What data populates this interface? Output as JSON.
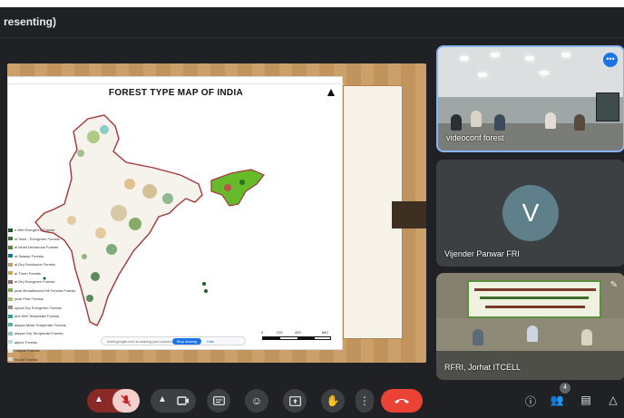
{
  "presentation": {
    "title_partial": "resenting)",
    "map_title": "FOREST TYPE MAP OF INDIA",
    "legend": [
      {
        "label": "e Wet Evergreen Forests",
        "color": "#1b5e20"
      },
      {
        "label": "al Semi - Evergreen Forests",
        "color": "#2e7d32"
      },
      {
        "label": "al Moist Deciduous Forests",
        "color": "#558b2f"
      },
      {
        "label": "al Swamp Forests",
        "color": "#00838f"
      },
      {
        "label": "al Dry Deciduous Forests",
        "color": "#c0a060"
      },
      {
        "label": "al Thorn Forests",
        "color": "#d4a24c"
      },
      {
        "label": "al Dry Evergreen Forests",
        "color": "#8d6e63"
      },
      {
        "label": "pical Broadleaved Hill Forests Forests",
        "color": "#7cb342"
      },
      {
        "label": "pical Pine Forests",
        "color": "#9ccc65"
      },
      {
        "label": "opical Dry Evergreen Forests",
        "color": "#a1887f"
      },
      {
        "label": "ane Wet Temperate Forests",
        "color": "#26a69a"
      },
      {
        "label": "alayan Moist Temperate Forests",
        "color": "#4db6ac"
      },
      {
        "label": "alayan Dry Temperate Forests",
        "color": "#80cbc4"
      },
      {
        "label": "alpine Forests",
        "color": "#b2dfdb"
      },
      {
        "label": "t Alpine Forests",
        "color": "#e0f2f1"
      },
      {
        "label": "Alpine Forests",
        "color": "#cfd8dc"
      }
    ],
    "footer_text": "meet.google.com is sharing your screen.",
    "stop_sharing": "Stop sharing",
    "hide": "Hide",
    "scale_labels": [
      "0",
      "210",
      "420",
      "840"
    ]
  },
  "participants": [
    {
      "name": "videoconf forest",
      "icon": "more-icon",
      "active": true
    },
    {
      "name": "Vijender Panwar FRI",
      "avatar_letter": "V",
      "avatar_color": "#5f7f8a"
    },
    {
      "name": "RFRI, Jorhat ITCELL",
      "icon": "pin-icon"
    }
  ],
  "toolbar": {
    "mic_state": "muted",
    "buttons": [
      "mic-options",
      "mic",
      "camera-options",
      "camera",
      "captions",
      "reactions",
      "present-now",
      "raise-hand",
      "more-options",
      "leave-call"
    ],
    "right_icons": [
      "meeting-details",
      "people",
      "chat",
      "activities"
    ],
    "people_count": "4",
    "colors": {
      "end_call": "#ea4335",
      "mic_muted_bg": "#f4cfcb",
      "accent": "#8ab4f8"
    }
  }
}
